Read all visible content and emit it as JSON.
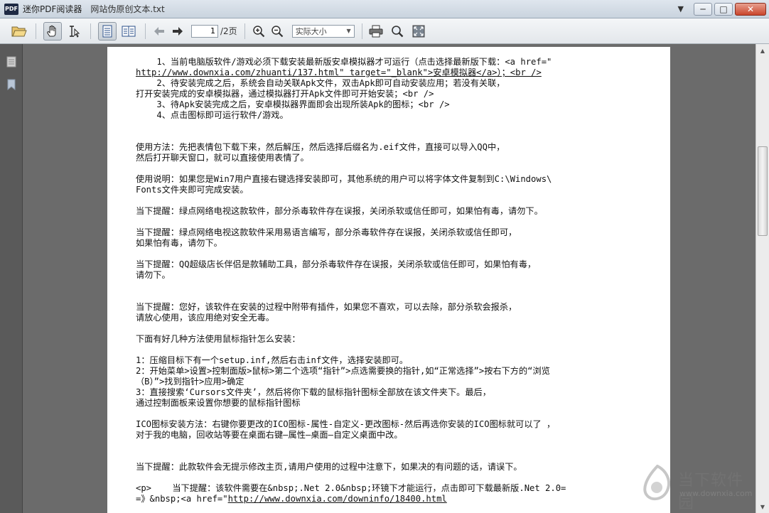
{
  "window": {
    "app_name": "迷你PDF阅读器",
    "doc_name": "网站伪原创文本.txt",
    "logo_text": "PDF",
    "menu_arrow": "▼",
    "minimize": "─",
    "maximize": "□",
    "close": "✕"
  },
  "toolbar": {
    "page_current": "1",
    "page_total": "/2页",
    "zoom_value": "实际大小"
  },
  "content": {
    "l1": "    1、当前电脑版软件/游戏必须下载安装最新版安卓模拟器才可运行（点击选择最新版下载：<a href=\"",
    "l2": "http://www.downxia.com/zhuanti/137.html\" target=\"_blank\">安卓模拟器</a>）；<br />",
    "l3": "    2、待安装完成之后，系统会自动关联Apk文件，双击Apk即可自动安装应用；若没有关联，",
    "l4": "打开安装完成的安卓模拟器，通过模拟器打开Apk文件即可开始安装；<br />",
    "l5": "    3、待Apk安装完成之后，安卓模拟器界面即会出现所装Apk的图标；<br />",
    "l6": "    4、点击图标即可运行软件/游戏。",
    "l7": "使用方法：先把表情包下载下来，然后解压，然后选择后缀名为.eif文件，直接可以导入QQ中，",
    "l8": "然后打开聊天窗口，就可以直接使用表情了。",
    "l9": "使用说明：如果您是Win7用户直接右键选择安装即可，其他系统的用户可以将字体文件复制到C:\\Windows\\",
    "l10": "Fonts文件夹即可完成安装。",
    "l11": "当下提醒：绿点网络电视这款软件，部分杀毒软件存在误报，关闭杀软或信任即可，如果怕有毒，请勿下。",
    "l12": "当下提醒：绿点网络电视这款软件采用易语言编写，部分杀毒软件存在误报，关闭杀软或信任即可，",
    "l13": "如果怕有毒，请勿下。",
    "l14": "当下提醒：QQ超级店长伴侣是款辅助工具，部分杀毒软件存在误报，关闭杀软或信任即可，如果怕有毒，",
    "l15": "请勿下。",
    "l16": "当下提醒：您好，该软件在安装的过程中附带有插件，如果您不喜欢，可以去除，部分杀软会报杀，",
    "l17": "请放心使用，该应用绝对安全无毒。",
    "l18": "下面有好几种方法使用鼠标指针怎么安装：",
    "l19": "1：压缩目标下有一个setup.inf,然后右击inf文件，选择安装即可。",
    "l20": "2：开始菜单>设置>控制面版>鼠标>第二个选项“指针”>点选需要换的指针,如“正常选择”>按右下方的“浏览",
    "l21": "（B）”>找到指针>应用>确定",
    "l22": "3：直接搜索‘Cursors文件夹’，然后将你下载的鼠标指针图标全部放在该文件夹下。最后，",
    "l23": "通过控制面板来设置你想要的鼠标指针图标",
    "l24": "ICO图标安装方法：右键你要更改的ICO图标-属性-自定义-更改图标-然后再选你安装的ICO图标就可以了 ，",
    "l25": "对于我的电脑，回收站等要在桌面右键—属性—桌面—自定义桌面中改。",
    "l26": "当下提醒：此款软件会无提示修改主页,请用户使用的过程中注意下，如果决的有问题的话，请误下。",
    "l27": "<p>    当下提醒：该软件需要在&nbsp;.Net 2.0&nbsp;环镜下才能运行，点击即可下载最新版.Net 2.0=",
    "l28a": "=》&nbsp;<a href=\"",
    "l28b": "http://www.downxia.com/downinfo/18400.html"
  },
  "watermark": {
    "name": "当下软件园",
    "url": "www.downxia.com"
  }
}
